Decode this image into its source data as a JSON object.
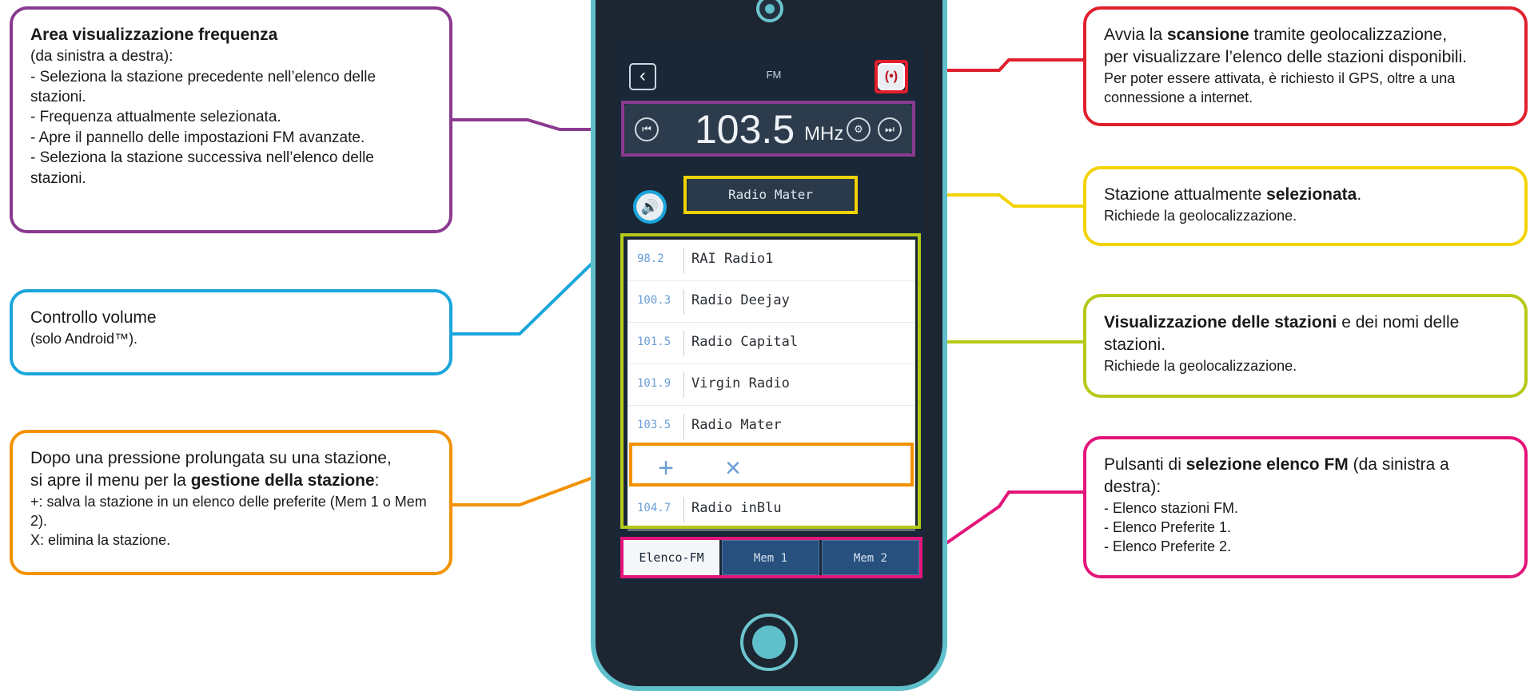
{
  "colors": {
    "purple": "#8a3b8f",
    "red": "#e01f2d",
    "yellow": "#f2d300",
    "blue": "#1aa6dc",
    "lime": "#b6c918",
    "orange": "#f29200",
    "magenta": "#e4157a",
    "phone_frame": "#5fbfcb"
  },
  "callouts": {
    "frequency": {
      "title": "Area visualizzazione frequenza",
      "lines": [
        "(da sinistra a destra):",
        "- Seleziona la stazione precedente nell’elenco delle stazioni.",
        "- Frequenza attualmente selezionata.",
        "- Apre il pannello delle impostazioni FM avanzate.",
        "- Seleziona la stazione successiva nell’elenco delle stazioni."
      ]
    },
    "scan": {
      "pre": "Avvia la ",
      "bold": "scansione",
      "post": " tramite geolocalizzazione,",
      "line2": "per visualizzare l’elenco delle stazioni disponibili.",
      "note": "Per poter essere attivata, è richiesto il GPS, oltre a una connessione a internet."
    },
    "current_station": {
      "pre": "Stazione attualmente ",
      "bold": "selezionata",
      "post": ".",
      "note": "Richiede la geolocalizzazione."
    },
    "volume": {
      "title": "Controllo volume",
      "note": "(solo Android™)."
    },
    "stations_view": {
      "bold": "Visualizzazione delle stazioni",
      "post": " e dei nomi delle stazioni.",
      "note": "Richiede la geolocalizzazione."
    },
    "manage": {
      "line1": "Dopo una pressione prolungata su una stazione,",
      "pre": "si apre il menu per la ",
      "bold": "gestione della stazione",
      "post": ":",
      "line3": "+: salva la stazione in un elenco delle preferite (Mem 1 o Mem 2).",
      "line4": "X: elimina la stazione."
    },
    "list_select": {
      "pre": "Pulsanti di ",
      "bold": "selezione elenco FM",
      "post": " (da sinistra a destra):",
      "lines": [
        "- Elenco stazioni FM.",
        "- Elenco Preferite 1.",
        "- Elenco Preferite 2."
      ]
    }
  },
  "app": {
    "back_icon": "chevron-left",
    "header_title": "FM",
    "scan_icon": "radio-waves",
    "frequency_value": "103.5",
    "frequency_unit": "MHz",
    "current_station": "Radio Mater",
    "stations": [
      {
        "freq": "98.2",
        "name": "RAI Radio1"
      },
      {
        "freq": "100.3",
        "name": "Radio Deejay"
      },
      {
        "freq": "101.5",
        "name": "Radio Capital"
      },
      {
        "freq": "101.9",
        "name": "Virgin Radio"
      },
      {
        "freq": "103.5",
        "name": "Radio Mater"
      },
      {
        "freq": "104.7",
        "name": "Radio inBlu"
      }
    ],
    "actions": {
      "add": "+",
      "delete": "×"
    },
    "tabs": [
      "Elenco-FM",
      "Mem 1",
      "Mem 2"
    ]
  }
}
